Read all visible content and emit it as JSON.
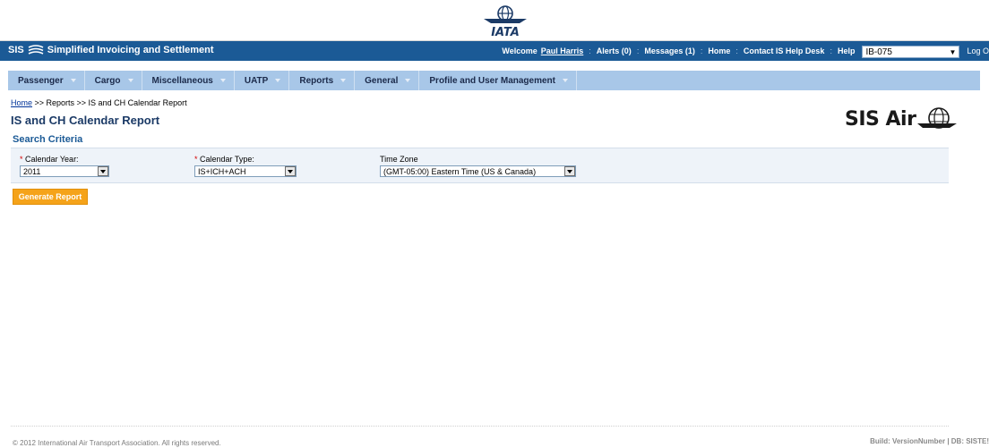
{
  "logo": {
    "iata_text": "IATA"
  },
  "header": {
    "app_sis": "SIS",
    "app_title": "Simplified Invoicing and Settlement",
    "welcome": "Welcome",
    "user_name": "Paul Harris",
    "alerts": "Alerts (0)",
    "messages": "Messages (1)",
    "home": "Home",
    "contact": "Contact IS Help Desk",
    "help": "Help",
    "member_code": "IB-075",
    "logout": "Log O"
  },
  "nav": {
    "items": [
      "Passenger",
      "Cargo",
      "Miscellaneous",
      "UATP",
      "Reports",
      "General",
      "Profile and User Management"
    ]
  },
  "breadcrumb": {
    "home": "Home",
    "rest": " >> Reports >> IS and CH Calendar Report"
  },
  "page": {
    "title": "IS and CH Calendar Report",
    "brand_logo_text": "SIS Air",
    "section_title": "Search Criteria"
  },
  "form": {
    "calendar_year": {
      "required": "*",
      "label": " Calendar Year:",
      "value": "2011"
    },
    "calendar_type": {
      "required": "*",
      "label": " Calendar Type:",
      "value": "IS+ICH+ACH"
    },
    "time_zone": {
      "label": "Time Zone",
      "value": "(GMT-05:00) Eastern Time (US & Canada)"
    },
    "generate_label": "Generate Report"
  },
  "footer": {
    "copyright": "© 2012 International Air Transport Association. All rights reserved.",
    "build": "Build: VersionNumber | DB: SISTE!"
  },
  "colors": {
    "header_blue": "#1b5a96",
    "nav_blue": "#a8c7e8",
    "button_orange": "#f5a31a",
    "required_red": "#d40000"
  }
}
